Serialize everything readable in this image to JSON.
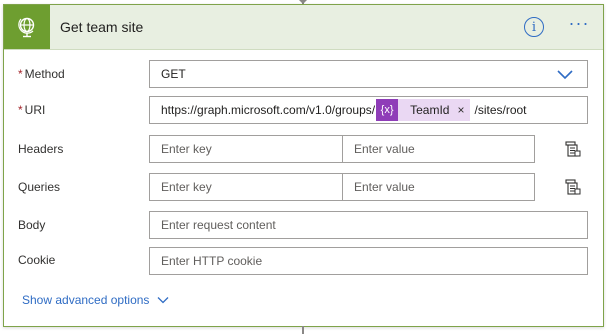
{
  "card": {
    "title": "Get team site",
    "header_icon": "globe-icon",
    "info_icon": "info-icon",
    "info_glyph": "i",
    "more_icon": "more-options-icon",
    "more_glyph": "···",
    "accent_color": "#6e9e30",
    "link_color": "#2f6cc4"
  },
  "fields": {
    "method": {
      "label": "Method",
      "required": "*",
      "value": "GET"
    },
    "uri": {
      "label": "URI",
      "required": "*",
      "prefix": "https://graph.microsoft.com/v1.0/groups/",
      "token_icon": "{x}",
      "token_label": "TeamId",
      "token_remove": "×",
      "suffix": "/sites/root"
    },
    "headers": {
      "label": "Headers",
      "key_placeholder": "Enter key",
      "value_placeholder": "Enter value"
    },
    "queries": {
      "label": "Queries",
      "key_placeholder": "Enter key",
      "value_placeholder": "Enter value"
    },
    "body": {
      "label": "Body",
      "placeholder": "Enter request content"
    },
    "cookie": {
      "label": "Cookie",
      "placeholder": "Enter HTTP cookie"
    }
  },
  "footer": {
    "advanced_label": "Show advanced options"
  }
}
